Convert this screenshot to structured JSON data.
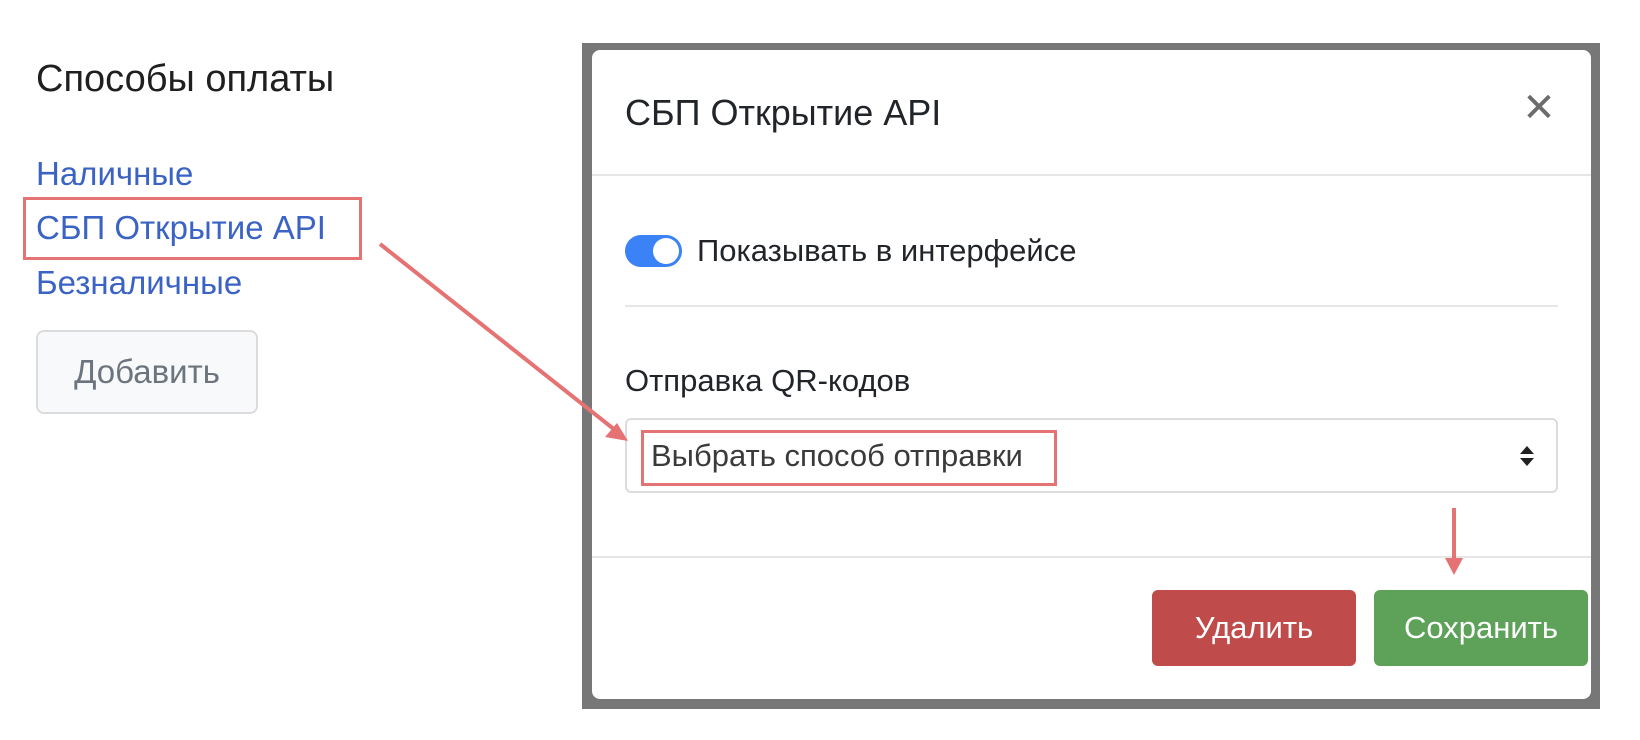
{
  "page": {
    "heading": "Способы оплаты",
    "payment_methods": [
      {
        "label": "Наличные"
      },
      {
        "label": "СБП Открытие API"
      },
      {
        "label": "Безналичные"
      }
    ],
    "add_button": "Добавить"
  },
  "modal": {
    "title": "СБП Открытие API",
    "close_symbol": "✕",
    "toggle": {
      "label": "Показывать в интерфейсе",
      "checked": true
    },
    "qr_field": {
      "label": "Отправка QR-кодов",
      "selected": "Выбрать способ отправки"
    },
    "buttons": {
      "delete": "Удалить",
      "save": "Сохранить"
    }
  },
  "colors": {
    "link": "#3b63c4",
    "toggle_on": "#3b82f6",
    "delete": "#c04b4b",
    "save": "#5ea25a",
    "annotation": "#e57373"
  },
  "icons": [
    "close-icon",
    "select-caret-icon",
    "arrow-annotation-icon"
  ]
}
